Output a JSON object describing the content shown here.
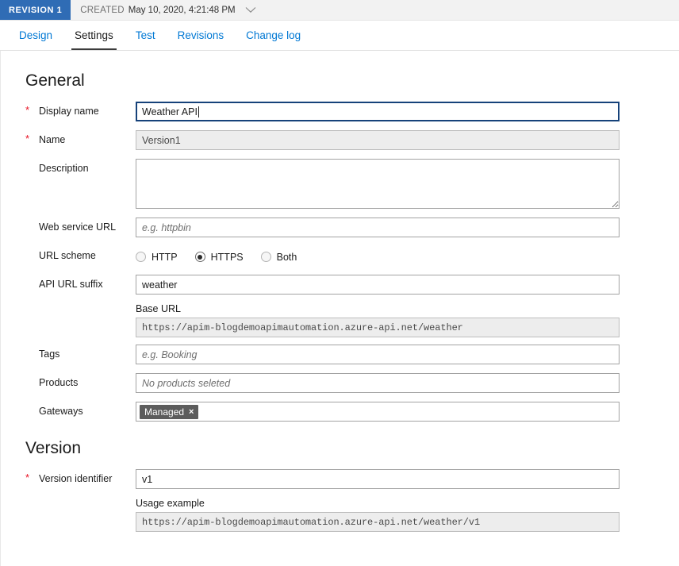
{
  "revision": {
    "badge": "REVISION 1",
    "created_label": "CREATED",
    "created_date": "May 10, 2020, 4:21:48 PM",
    "badge_color": "#2f6cb5",
    "dropdown_icon": "chevron-down-icon"
  },
  "tabs": [
    {
      "label": "Design",
      "active": false
    },
    {
      "label": "Settings",
      "active": true
    },
    {
      "label": "Test",
      "active": false
    },
    {
      "label": "Revisions",
      "active": false
    },
    {
      "label": "Change log",
      "active": false
    }
  ],
  "general": {
    "title": "General",
    "display_name": {
      "label": "Display name",
      "required": true,
      "value": "Weather API",
      "focused": true
    },
    "name": {
      "label": "Name",
      "required": true,
      "value": "Version1",
      "disabled": true
    },
    "description": {
      "label": "Description",
      "required": false,
      "value": "",
      "placeholder": ""
    },
    "web_service_url": {
      "label": "Web service URL",
      "required": false,
      "value": "",
      "placeholder": "e.g. httpbin"
    },
    "url_scheme": {
      "label": "URL scheme",
      "required": false,
      "options": [
        "HTTP",
        "HTTPS",
        "Both"
      ],
      "selected": "HTTPS"
    },
    "api_url_suffix": {
      "label": "API URL suffix",
      "required": false,
      "value": "weather"
    },
    "base_url": {
      "label": "Base URL",
      "value": "https://apim-blogdemoapimautomation.azure-api.net/weather",
      "readonly": true
    },
    "tags": {
      "label": "Tags",
      "required": false,
      "value": "",
      "placeholder": "e.g. Booking"
    },
    "products": {
      "label": "Products",
      "required": false,
      "value": "",
      "placeholder": "No products seleted"
    },
    "gateways": {
      "label": "Gateways",
      "required": false,
      "tags": [
        {
          "label": "Managed",
          "remove_icon": "×"
        }
      ]
    }
  },
  "version": {
    "title": "Version",
    "version_identifier": {
      "label": "Version identifier",
      "required": true,
      "value": "v1"
    },
    "usage_example": {
      "label": "Usage example",
      "value": "https://apim-blogdemoapimautomation.azure-api.net/weather/v1",
      "readonly": true
    }
  }
}
